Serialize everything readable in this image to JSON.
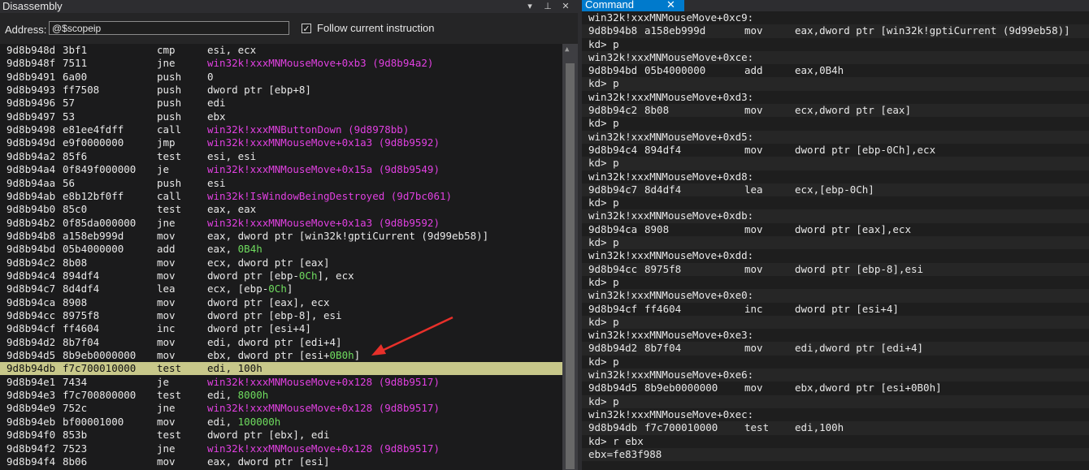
{
  "disassembly": {
    "title": "Disassembly",
    "buttons": {
      "dropdown": "▾",
      "pin": "⊥",
      "close": "✕"
    },
    "address_label": "Address:",
    "address_value": "@$scopeip",
    "follow_checked": "✓",
    "follow_label": "Follow current instruction",
    "lines": [
      {
        "addr": "9d8b948d",
        "bytes": "3bf1",
        "mn": "cmp",
        "op": "esi, ecx"
      },
      {
        "addr": "9d8b948f",
        "bytes": "7511",
        "mn": "jne",
        "op": "win32k!xxxMNMouseMove+0xb3 (9d8b94a2)",
        "sym": true
      },
      {
        "addr": "9d8b9491",
        "bytes": "6a00",
        "mn": "push",
        "op": "0"
      },
      {
        "addr": "9d8b9493",
        "bytes": "ff7508",
        "mn": "push",
        "op": "dword ptr [ebp+8]"
      },
      {
        "addr": "9d8b9496",
        "bytes": "57",
        "mn": "push",
        "op": "edi"
      },
      {
        "addr": "9d8b9497",
        "bytes": "53",
        "mn": "push",
        "op": "ebx"
      },
      {
        "addr": "9d8b9498",
        "bytes": "e81ee4fdff",
        "mn": "call",
        "op": "win32k!xxxMNButtonDown (9d8978bb)",
        "sym": true
      },
      {
        "addr": "9d8b949d",
        "bytes": "e9f0000000",
        "mn": "jmp",
        "op": "win32k!xxxMNMouseMove+0x1a3 (9d8b9592)",
        "sym": true
      },
      {
        "addr": "9d8b94a2",
        "bytes": "85f6",
        "mn": "test",
        "op": "esi, esi"
      },
      {
        "addr": "9d8b94a4",
        "bytes": "0f849f000000",
        "mn": "je",
        "op": "win32k!xxxMNMouseMove+0x15a (9d8b9549)",
        "sym": true
      },
      {
        "addr": "9d8b94aa",
        "bytes": "56",
        "mn": "push",
        "op": "esi"
      },
      {
        "addr": "9d8b94ab",
        "bytes": "e8b12bf0ff",
        "mn": "call",
        "op": "win32k!IsWindowBeingDestroyed (9d7bc061)",
        "sym": true
      },
      {
        "addr": "9d8b94b0",
        "bytes": "85c0",
        "mn": "test",
        "op": "eax, eax"
      },
      {
        "addr": "9d8b94b2",
        "bytes": "0f85da000000",
        "mn": "jne",
        "op": "win32k!xxxMNMouseMove+0x1a3 (9d8b9592)",
        "sym": true
      },
      {
        "addr": "9d8b94b8",
        "bytes": "a158eb999d",
        "mn": "mov",
        "op": "eax, dword ptr [win32k!gptiCurrent (9d99eb58)]"
      },
      {
        "addr": "9d8b94bd",
        "bytes": "05b4000000",
        "mn": "add",
        "op": "eax, ",
        "imm": "0B4h"
      },
      {
        "addr": "9d8b94c2",
        "bytes": "8b08",
        "mn": "mov",
        "op": "ecx, dword ptr [eax]"
      },
      {
        "addr": "9d8b94c4",
        "bytes": "894df4",
        "mn": "mov",
        "op": "dword ptr [ebp-",
        "imm": "0Ch",
        "op2": "], ecx"
      },
      {
        "addr": "9d8b94c7",
        "bytes": "8d4df4",
        "mn": "lea",
        "op": "ecx, [ebp-",
        "imm": "0Ch",
        "op2": "]"
      },
      {
        "addr": "9d8b94ca",
        "bytes": "8908",
        "mn": "mov",
        "op": "dword ptr [eax], ecx"
      },
      {
        "addr": "9d8b94cc",
        "bytes": "8975f8",
        "mn": "mov",
        "op": "dword ptr [ebp-8], esi"
      },
      {
        "addr": "9d8b94cf",
        "bytes": "ff4604",
        "mn": "inc",
        "op": "dword ptr [esi+4]"
      },
      {
        "addr": "9d8b94d2",
        "bytes": "8b7f04",
        "mn": "mov",
        "op": "edi, dword ptr [edi+4]"
      },
      {
        "addr": "9d8b94d5",
        "bytes": "8b9eb0000000",
        "mn": "mov",
        "op": "ebx, dword ptr [esi+",
        "imm": "0B0h",
        "op2": "]"
      },
      {
        "addr": "9d8b94db",
        "bytes": "f7c700010000",
        "mn": "test",
        "op": "edi, 100h",
        "current": true
      },
      {
        "addr": "9d8b94e1",
        "bytes": "7434",
        "mn": "je",
        "op": "win32k!xxxMNMouseMove+0x128 (9d8b9517)",
        "sym": true
      },
      {
        "addr": "9d8b94e3",
        "bytes": "f7c700800000",
        "mn": "test",
        "op": "edi, ",
        "imm": "8000h"
      },
      {
        "addr": "9d8b94e9",
        "bytes": "752c",
        "mn": "jne",
        "op": "win32k!xxxMNMouseMove+0x128 (9d8b9517)",
        "sym": true
      },
      {
        "addr": "9d8b94eb",
        "bytes": "bf00001000",
        "mn": "mov",
        "op": "edi, ",
        "imm": "100000h"
      },
      {
        "addr": "9d8b94f0",
        "bytes": "853b",
        "mn": "test",
        "op": "dword ptr [ebx], edi"
      },
      {
        "addr": "9d8b94f2",
        "bytes": "7523",
        "mn": "jne",
        "op": "win32k!xxxMNMouseMove+0x128 (9d8b9517)",
        "sym": true
      },
      {
        "addr": "9d8b94f4",
        "bytes": "8b06",
        "mn": "mov",
        "op": "eax, dword ptr [esi]"
      }
    ]
  },
  "command": {
    "tab_label": "Command",
    "tab_close": "✕",
    "lines": [
      {
        "text": "win32k!xxxMNMouseMove+0xc9:"
      },
      {
        "addr": "9d8b94b8",
        "bytes": "a158eb999d",
        "mn": "mov",
        "op": "eax,dword ptr [win32k!gptiCurrent (9d99eb58)]"
      },
      {
        "text": "kd> p"
      },
      {
        "text": "win32k!xxxMNMouseMove+0xce:"
      },
      {
        "addr": "9d8b94bd",
        "bytes": "05b4000000",
        "mn": "add",
        "op": "eax,0B4h"
      },
      {
        "text": "kd> p"
      },
      {
        "text": "win32k!xxxMNMouseMove+0xd3:"
      },
      {
        "addr": "9d8b94c2",
        "bytes": "8b08",
        "mn": "mov",
        "op": "ecx,dword ptr [eax]"
      },
      {
        "text": "kd> p"
      },
      {
        "text": "win32k!xxxMNMouseMove+0xd5:"
      },
      {
        "addr": "9d8b94c4",
        "bytes": "894df4",
        "mn": "mov",
        "op": "dword ptr [ebp-0Ch],ecx"
      },
      {
        "text": "kd> p"
      },
      {
        "text": "win32k!xxxMNMouseMove+0xd8:"
      },
      {
        "addr": "9d8b94c7",
        "bytes": "8d4df4",
        "mn": "lea",
        "op": "ecx,[ebp-0Ch]"
      },
      {
        "text": "kd> p"
      },
      {
        "text": "win32k!xxxMNMouseMove+0xdb:"
      },
      {
        "addr": "9d8b94ca",
        "bytes": "8908",
        "mn": "mov",
        "op": "dword ptr [eax],ecx"
      },
      {
        "text": "kd> p"
      },
      {
        "text": "win32k!xxxMNMouseMove+0xdd:"
      },
      {
        "addr": "9d8b94cc",
        "bytes": "8975f8",
        "mn": "mov",
        "op": "dword ptr [ebp-8],esi"
      },
      {
        "text": "kd> p"
      },
      {
        "text": "win32k!xxxMNMouseMove+0xe0:"
      },
      {
        "addr": "9d8b94cf",
        "bytes": "ff4604",
        "mn": "inc",
        "op": "dword ptr [esi+4]"
      },
      {
        "text": "kd> p"
      },
      {
        "text": "win32k!xxxMNMouseMove+0xe3:"
      },
      {
        "addr": "9d8b94d2",
        "bytes": "8b7f04",
        "mn": "mov",
        "op": "edi,dword ptr [edi+4]"
      },
      {
        "text": "kd> p"
      },
      {
        "text": "win32k!xxxMNMouseMove+0xe6:"
      },
      {
        "addr": "9d8b94d5",
        "bytes": "8b9eb0000000",
        "mn": "mov",
        "op": "ebx,dword ptr [esi+0B0h]"
      },
      {
        "text": "kd> p"
      },
      {
        "text": "win32k!xxxMNMouseMove+0xec:"
      },
      {
        "addr": "9d8b94db",
        "bytes": "f7c700010000",
        "mn": "test",
        "op": "edi,100h"
      },
      {
        "text": "kd> r ebx"
      },
      {
        "text": "ebx=fe83f988"
      }
    ]
  },
  "annotation": {
    "arrow_icon": "red-arrow-icon",
    "arrow_color": "#e8302a"
  },
  "colors": {
    "symbol": "#e040e0",
    "immediate": "#6fdc5f",
    "current_line": "#c8c88a",
    "tab_active": "#007acc"
  }
}
